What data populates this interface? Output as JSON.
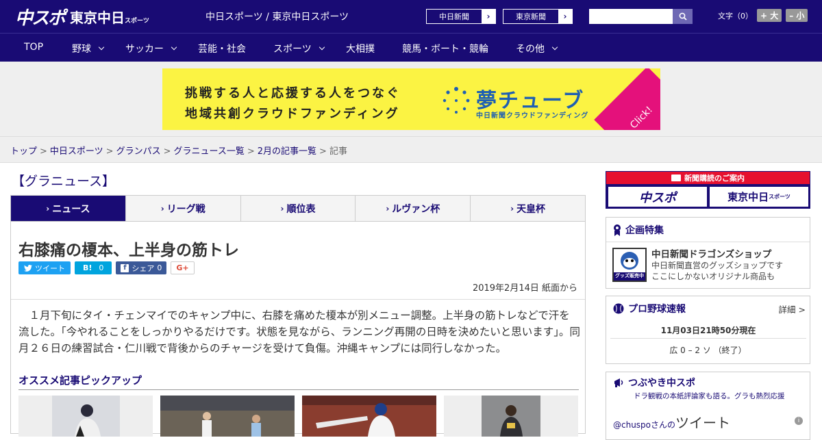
{
  "header": {
    "logo_main": "中スポ",
    "logo_tokyo": "東京中日",
    "logo_tokyo_small": "スポーツ",
    "site_title": "中日スポーツ / 東京中日スポーツ",
    "paper1": "中日新聞",
    "paper2": "東京新聞",
    "search_placeholder": "",
    "font_label": "文字（0）",
    "font_bigger": "+ 大",
    "font_smaller": "– 小"
  },
  "nav": {
    "items": [
      {
        "label": "TOP",
        "dropdown": false
      },
      {
        "label": "野球",
        "dropdown": true
      },
      {
        "label": "サッカー",
        "dropdown": true
      },
      {
        "label": "芸能・社会",
        "dropdown": false
      },
      {
        "label": "スポーツ",
        "dropdown": true
      },
      {
        "label": "大相撲",
        "dropdown": false
      },
      {
        "label": "競馬・ボート・競輪",
        "dropdown": false
      },
      {
        "label": "その他",
        "dropdown": true
      }
    ]
  },
  "ad": {
    "line1": "挑戦する人と応援する人をつなぐ",
    "line2": "地域共創クラウドファンディング",
    "brand": "夢チューブ",
    "brand_sub": "中日新聞クラウドファンディング",
    "click": "Click!"
  },
  "breadcrumb": {
    "items": [
      "トップ",
      "中日スポーツ",
      "グランパス",
      "グラニュース一覧",
      "2月の記事一覧"
    ],
    "current": "記事",
    "separator": ">"
  },
  "category_title": "【グラニュース】",
  "tabs": [
    {
      "label": "ニュース",
      "active": true
    },
    {
      "label": "リーグ戦",
      "active": false
    },
    {
      "label": "順位表",
      "active": false
    },
    {
      "label": "ルヴァン杯",
      "active": false
    },
    {
      "label": "天皇杯",
      "active": false
    }
  ],
  "article": {
    "title": "右膝痛の榎本、上半身の筋トレ",
    "share": {
      "tweet": "ツイート",
      "hatena": "B!",
      "hatena_count": "0",
      "fb": "シェア",
      "fb_count": "0",
      "gplus": "G+"
    },
    "date": "2019年2月14日 紙面から",
    "body": "１月下旬にタイ・チェンマイでのキャンプ中に、右膝を痛めた榎本が別メニュー調整。上半身の筋トレなどで汗を流した。「今やれることをしっかりやるだけです。状態を見ながら、ランニング再開の日時を決めたいと思います」。同月２６日の練習試合・仁川戦で背後からのチャージを受けて負傷。沖縄キャンプには同行しなかった。",
    "pickup_title": "オススメ記事ピックアップ"
  },
  "sidebar": {
    "subscribe_title": "新聞購読のご案内",
    "subscribe_b1": "中スポ",
    "subscribe_b2": "東京中日",
    "subscribe_b2_small": "スポーツ",
    "kikaku_title": "企画特集",
    "kikaku_item_title": "中日新聞ドラゴンズショップ",
    "kikaku_item_desc1": "中日新聞直営のグッズショップです",
    "kikaku_item_desc2": "ここにしかないオリジナル商品も",
    "kikaku_thumb_label": "グッズ販売中",
    "sokuho_title": "プロ野球速報",
    "sokuho_detail": "詳細 >",
    "sokuho_time": "11月03日21時50分現在",
    "sokuho_score": "広 0 – 2 ソ （終了）",
    "tsubu_title": "つぶやき中スポ",
    "tsubu_sub": "ドラ観戦の本紙評論家も語る。グラも熱烈応援",
    "tsubu_handle": "@chuspoさんの",
    "tsubu_tweet": "ツイート"
  },
  "colors": {
    "brand_navy": "#190b74",
    "ad_yellow": "#fbf343",
    "accent_red": "#e6102f",
    "twitter": "#1da1f2",
    "hatena": "#00a4de",
    "facebook": "#3b5998"
  }
}
